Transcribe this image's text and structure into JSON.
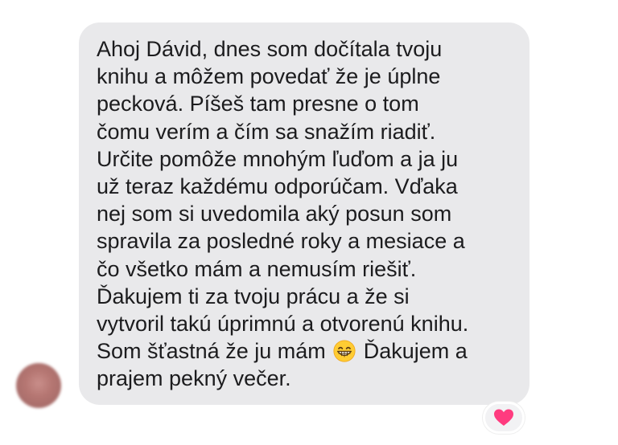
{
  "message": {
    "lines_before_emoji": [
      "Ahoj Dávid, dnes som dočítala tvoju",
      "knihu a môžem povedať že je úplne",
      "pecková. Píšeš tam presne o tom",
      "čomu verím a čím sa snažím riadiť.",
      "Určite pomôže mnohým ľuďom a ja ju",
      "už teraz každému odporúčam. Vďaka",
      "nej som si uvedomila aký posun som",
      "spravila za posledné roky a mesiace a",
      "čo všetko mám a nemusím riešiť.",
      "Ďakujem ti za tvoju prácu a že si",
      "vytvoril takú úprimnú a otvorenú knihu."
    ],
    "emoji_line_start": "Som šťastná že ju mám",
    "emoji_icon": "grinning-face-emoji",
    "emoji_line_end": "Ďakujem a",
    "last_line": "prajem pekný večer."
  },
  "reaction": {
    "icon": "heart-icon",
    "color": "#ff3b7f"
  },
  "colors": {
    "bubble": "#e9e9eb",
    "text": "#1c1c1e",
    "background": "#ffffff"
  }
}
